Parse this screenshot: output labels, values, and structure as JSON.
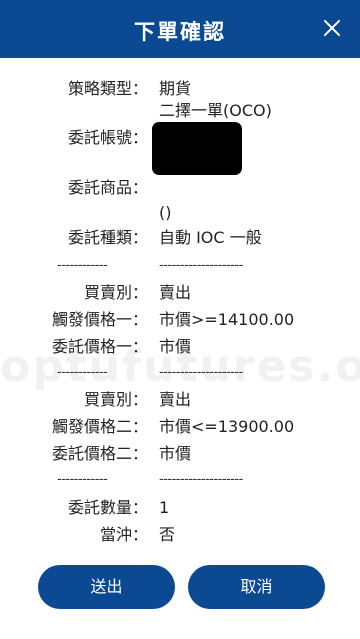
{
  "dialog": {
    "title": "下單確認",
    "close_icon": "close-icon"
  },
  "details": {
    "strategy_type_label": "策略類型：",
    "strategy_type_value_line1": "期貨",
    "strategy_type_value_line2": "二擇一單(OCO)",
    "account_label": "委託帳號：",
    "product_label": "委託商品：",
    "product_value": "()",
    "order_kind_label": "委託種類：",
    "order_kind_value": "自動 IOC 一般"
  },
  "leg1": {
    "side_label": "買賣別：",
    "side_value": "賣出",
    "trigger_label": "觸發價格一：",
    "trigger_value": "市價>=14100.00",
    "order_price_label": "委託價格一：",
    "order_price_value": "市價"
  },
  "leg2": {
    "side_label": "買賣別：",
    "side_value": "賣出",
    "trigger_label": "觸發價格二：",
    "trigger_value": "市價<=13900.00",
    "order_price_label": "委託價格二：",
    "order_price_value": "市價"
  },
  "summary": {
    "quantity_label": "委託數量：",
    "quantity_value": "1",
    "daytrade_label": "當沖：",
    "daytrade_value": "否"
  },
  "separators": {
    "left": "------------",
    "right": "--------------------"
  },
  "watermark": "optufutures.or",
  "buttons": {
    "confirm": "送出",
    "cancel": "取消"
  },
  "colors": {
    "primary": "#0b4a92",
    "text": "#222222"
  }
}
